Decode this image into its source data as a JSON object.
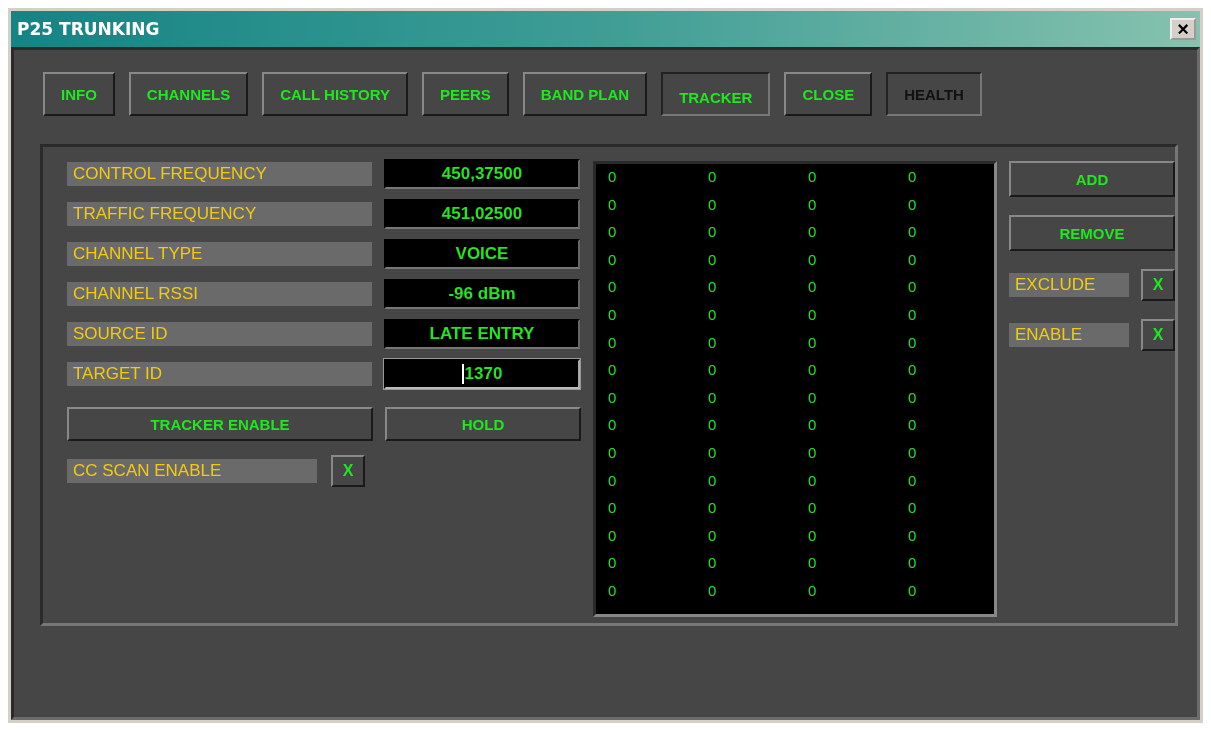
{
  "window": {
    "title": "P25 TRUNKING",
    "close": "×"
  },
  "tabs": [
    {
      "label": "INFO",
      "selected": false,
      "disabled": false
    },
    {
      "label": "CHANNELS",
      "selected": false,
      "disabled": false
    },
    {
      "label": "CALL HISTORY",
      "selected": false,
      "disabled": false
    },
    {
      "label": "PEERS",
      "selected": false,
      "disabled": false
    },
    {
      "label": "BAND PLAN",
      "selected": false,
      "disabled": false
    },
    {
      "label": "TRACKER",
      "selected": true,
      "disabled": false
    },
    {
      "label": "CLOSE",
      "selected": false,
      "disabled": false
    },
    {
      "label": "HEALTH",
      "selected": false,
      "disabled": true
    }
  ],
  "fields": [
    {
      "label": "CONTROL FREQUENCY",
      "value": "450,37500",
      "focused": false
    },
    {
      "label": "TRAFFIC FREQUENCY",
      "value": "451,02500",
      "focused": false
    },
    {
      "label": "CHANNEL TYPE",
      "value": "VOICE",
      "focused": false
    },
    {
      "label": "CHANNEL RSSI",
      "value": "-96 dBm",
      "focused": false
    },
    {
      "label": "SOURCE ID",
      "value": "LATE ENTRY",
      "focused": false
    },
    {
      "label": "TARGET ID",
      "value": "1370",
      "focused": true
    }
  ],
  "buttons": [
    "TRACKER ENABLE",
    "HOLD"
  ],
  "cc_scan": {
    "label": "CC SCAN ENABLE",
    "mark": "X",
    "checked": true
  },
  "list_rows": [
    [
      "0",
      "0",
      "0",
      "0"
    ],
    [
      "0",
      "0",
      "0",
      "0"
    ],
    [
      "0",
      "0",
      "0",
      "0"
    ],
    [
      "0",
      "0",
      "0",
      "0"
    ],
    [
      "0",
      "0",
      "0",
      "0"
    ],
    [
      "0",
      "0",
      "0",
      "0"
    ],
    [
      "0",
      "0",
      "0",
      "0"
    ],
    [
      "0",
      "0",
      "0",
      "0"
    ],
    [
      "0",
      "0",
      "0",
      "0"
    ],
    [
      "0",
      "0",
      "0",
      "0"
    ],
    [
      "0",
      "0",
      "0",
      "0"
    ],
    [
      "0",
      "0",
      "0",
      "0"
    ],
    [
      "0",
      "0",
      "0",
      "0"
    ],
    [
      "0",
      "0",
      "0",
      "0"
    ],
    [
      "0",
      "0",
      "0",
      "0"
    ],
    [
      "0",
      "0",
      "0",
      "0"
    ]
  ],
  "side_buttons": [
    "ADD",
    "REMOVE"
  ],
  "side_options": [
    {
      "label": "EXCLUDE",
      "mark": "X",
      "checked": true
    },
    {
      "label": "ENABLE",
      "mark": "X",
      "checked": true
    }
  ]
}
